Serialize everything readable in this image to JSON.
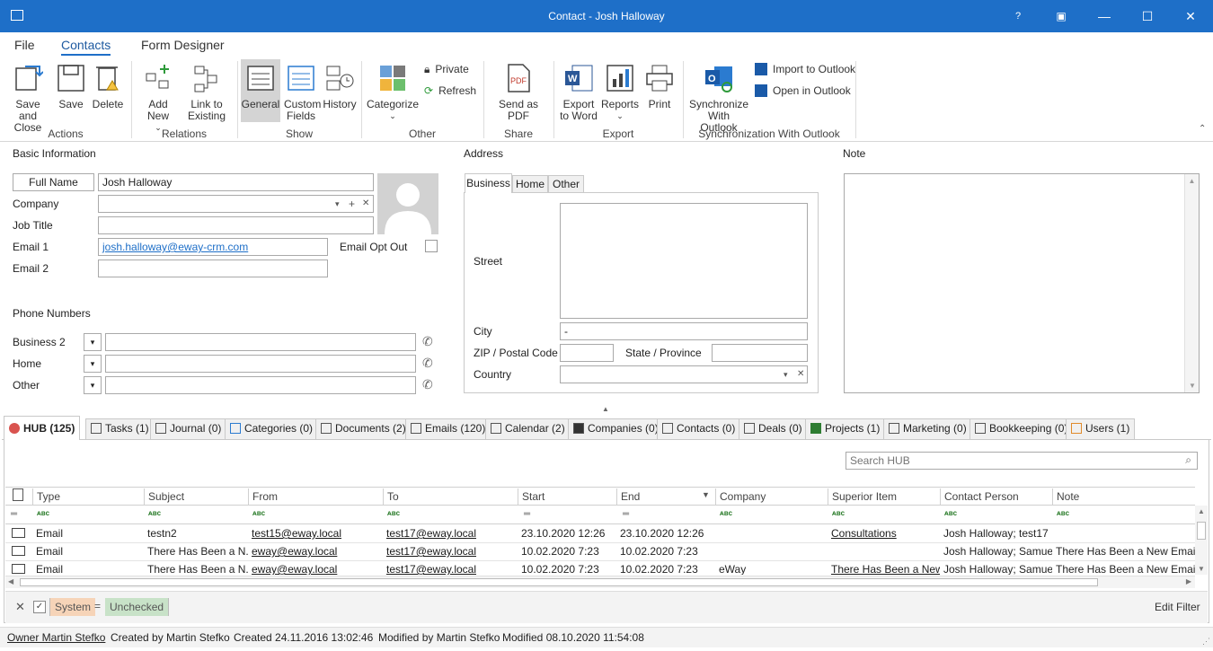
{
  "window": {
    "title": "Contact - Josh Halloway",
    "help": "?",
    "restore": "▣",
    "minimize": "—",
    "maximize": "☐",
    "close": "✕"
  },
  "menu": {
    "file": "File",
    "contacts": "Contacts",
    "form_designer": "Form Designer"
  },
  "ribbon": {
    "save_close": "Save and Close",
    "save": "Save",
    "delete": "Delete",
    "actions": "Actions",
    "add_new": "Add New",
    "link_existing": "Link to Existing",
    "relations": "Relations",
    "general": "General",
    "custom_fields": "Custom Fields",
    "history": "History",
    "show": "Show",
    "categorize": "Categorize",
    "private": "Private",
    "refresh": "Refresh",
    "other": "Other",
    "send_pdf": "Send as PDF",
    "share": "Share",
    "export_word": "Export to Word",
    "reports": "Reports",
    "print": "Print",
    "export": "Export",
    "sync_outlook": "Synchronize With Outlook",
    "import_outlook": "Import to Outlook",
    "open_outlook": "Open in Outlook",
    "sync_group": "Synchronization With Outlook"
  },
  "basic": {
    "section": "Basic Information",
    "full_name_btn": "Full Name",
    "full_name": "Josh Halloway",
    "company_lbl": "Company",
    "job_title_lbl": "Job Title",
    "email1_lbl": "Email 1",
    "email1": "josh.halloway@eway-crm.com",
    "email_opt_out": "Email Opt Out",
    "email2_lbl": "Email 2"
  },
  "phones": {
    "section": "Phone Numbers",
    "business2": "Business 2",
    "home": "Home",
    "other": "Other"
  },
  "address": {
    "section": "Address",
    "tabs": [
      "Business",
      "Home",
      "Other"
    ],
    "street": "Street",
    "city": "City",
    "city_value": "-",
    "zip": "ZIP / Postal Code",
    "state": "State / Province",
    "country": "Country"
  },
  "note": {
    "section": "Note"
  },
  "bottom_tabs": [
    "HUB (125)",
    "Tasks (1)",
    "Journal (0)",
    "Categories (0)",
    "Documents (2)",
    "Emails (120)",
    "Calendar (2)",
    "Companies (0)",
    "Contacts (0)",
    "Deals (0)",
    "Projects (1)",
    "Marketing (0)",
    "Bookkeeping (0)",
    "Users (1)"
  ],
  "grid": {
    "search_placeholder": "Search HUB",
    "columns": [
      "Type",
      "Subject",
      "From",
      "To",
      "Start",
      "End",
      "Company",
      "Superior Item",
      "Contact Person",
      "Note"
    ],
    "rows": [
      [
        "Email",
        "testn2",
        "test15@eway.local",
        "test17@eway.local",
        "23.10.2020 12:26",
        "23.10.2020 12:26",
        "",
        "Consultations",
        "Josh Halloway; test17",
        ""
      ],
      [
        "Email",
        "There Has Been a N...",
        "eway@eway.local",
        "test17@eway.local",
        "10.02.2020 7:23",
        "10.02.2020 7:23",
        "",
        "",
        "Josh Halloway; Samuel...",
        "There Has Been a New Email As"
      ],
      [
        "Email",
        "There Has Been a N...",
        "eway@eway.local",
        "test17@eway.local",
        "10.02.2020 7:23",
        "10.02.2020 7:23",
        "eWay",
        "There Has Been a New...",
        "Josh Halloway; Samuel...",
        "There Has Been a New Email As"
      ]
    ]
  },
  "filter": {
    "system": "System",
    "eq": "=",
    "unchecked": "Unchecked",
    "edit": "Edit Filter"
  },
  "status": {
    "owner": "Owner Martin Stefko",
    "created_by": "Created by Martin Stefko",
    "created": "Created 24.11.2016 13:02:46",
    "modified_by": "Modified by Martin Stefko",
    "modified": "Modified 08.10.2020 11:54:08"
  }
}
